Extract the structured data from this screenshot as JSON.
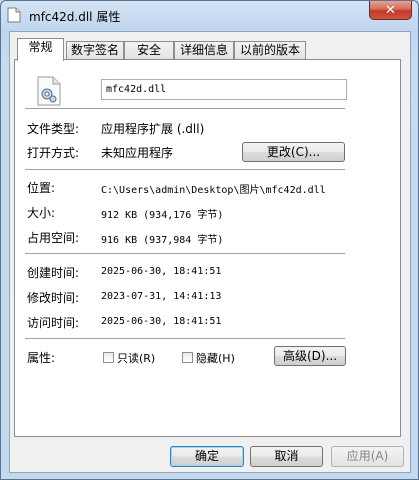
{
  "window": {
    "title": "mfc42d.dll 属性"
  },
  "tabs": [
    {
      "label": "常规",
      "active": true
    },
    {
      "label": "数字签名",
      "active": false
    },
    {
      "label": "安全",
      "active": false
    },
    {
      "label": "详细信息",
      "active": false
    },
    {
      "label": "以前的版本",
      "active": false
    }
  ],
  "general": {
    "file_name": "mfc42d.dll",
    "file_type": {
      "label": "文件类型:",
      "value": "应用程序扩展 (.dll)"
    },
    "opens_with": {
      "label": "打开方式:",
      "value": "未知应用程序",
      "button": "更改(C)..."
    },
    "location": {
      "label": "位置:",
      "value": "C:\\Users\\admin\\Desktop\\图片\\mfc42d.dll"
    },
    "size": {
      "label": "大小:",
      "value": "912 KB (934,176 字节)"
    },
    "size_on_disk": {
      "label": "占用空间:",
      "value": "916 KB (937,984 字节)"
    },
    "created": {
      "label": "创建时间:",
      "value": "2025-06-30, 18:41:51"
    },
    "modified": {
      "label": "修改时间:",
      "value": "2023-07-31, 14:41:13"
    },
    "accessed": {
      "label": "访问时间:",
      "value": "2025-06-30, 18:41:51"
    },
    "attributes": {
      "label": "属性:",
      "readonly": {
        "label": "只读(R)",
        "checked": false
      },
      "hidden": {
        "label": "隐藏(H)",
        "checked": false
      },
      "advanced_button": "高级(D)..."
    }
  },
  "footer": {
    "ok": "确定",
    "cancel": "取消",
    "apply": "应用(A)"
  },
  "colors": {
    "close_button": "#c0392b",
    "panel_bg": "#ffffff",
    "dialog_bg": "#f0f0f0",
    "frame": "#c4d8ee"
  }
}
